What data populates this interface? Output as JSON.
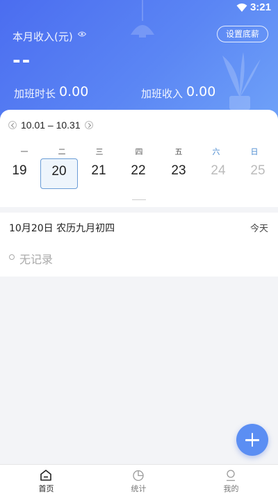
{
  "status_bar": {
    "time": "3:21",
    "wifi_icon": "wifi-icon"
  },
  "header": {
    "income_label": "本月收入(元)",
    "eye_icon": "eye-icon",
    "set_salary_label": "设置底薪",
    "income_value": "--",
    "overtime_hours_label": "加班时长",
    "overtime_hours_value": "0.00",
    "overtime_income_label": "加班收入",
    "overtime_income_value": "0.00",
    "colors": {
      "gradient_start": "#4b6df0",
      "gradient_end": "#6fa2f8"
    }
  },
  "calendar": {
    "range": "10.01 – 10.31",
    "weekdays": [
      "一",
      "二",
      "三",
      "四",
      "五",
      "六",
      "日"
    ],
    "dates": [
      "19",
      "20",
      "21",
      "22",
      "23",
      "24",
      "25"
    ],
    "selected_date": "20",
    "colors": {
      "weekend": "#4a8ad0",
      "selected_border": "#6a9cd6"
    }
  },
  "day_panel": {
    "title": "10月20日 农历九月初四",
    "today_label": "今天",
    "empty_text": "无记录"
  },
  "fab": {
    "icon": "plus-icon",
    "color": "#5b8ef3"
  },
  "tab_bar": {
    "tabs": [
      {
        "label": "首页",
        "icon": "home-icon",
        "active": true
      },
      {
        "label": "统计",
        "icon": "pie-chart-icon",
        "active": false
      },
      {
        "label": "我的",
        "icon": "profile-icon",
        "active": false
      }
    ]
  }
}
